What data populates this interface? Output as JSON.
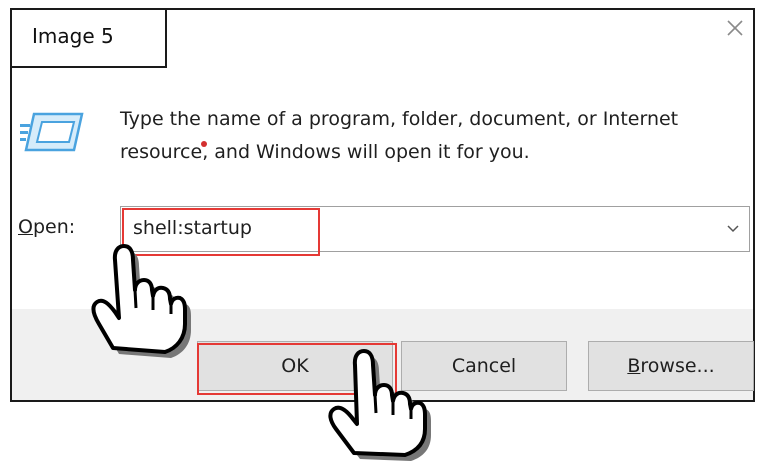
{
  "caption": "Image 5",
  "dialog": {
    "description_line1": "Type the name of a program, folder, document, or Internet",
    "description_line2_a": "resource",
    "description_line2_b": ", and Windows will open it for you.",
    "open_label_access": "O",
    "open_label_rest": "pen:",
    "open_value": "shell:startup",
    "buttons": {
      "ok": "OK",
      "cancel": "Cancel",
      "browse_access": "B",
      "browse_rest": "rowse..."
    }
  },
  "colors": {
    "highlight": "#e53935",
    "footer_bg": "#f0f0f0",
    "button_bg": "#e1e1e1",
    "icon_blue": "#4aa3df"
  },
  "icons": {
    "close": "close-icon",
    "run": "run-icon",
    "dropdown": "chevron-down-icon",
    "pointer": "hand-pointer-icon"
  }
}
